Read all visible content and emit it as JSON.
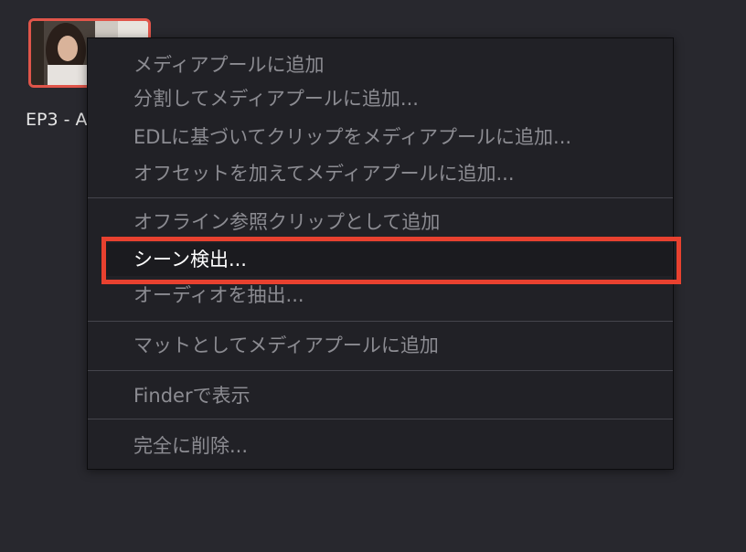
{
  "clip": {
    "label": "EP3 - A"
  },
  "context_menu": {
    "items": [
      {
        "label": "メディアプールに追加"
      },
      {
        "label": "分割してメディアプールに追加..."
      },
      {
        "label": "EDLに基づいてクリップをメディアプールに追加..."
      },
      {
        "label": "オフセットを加えてメディアプールに追加..."
      },
      {
        "label": "オフライン参照クリップとして追加"
      },
      {
        "label": "シーン検出...",
        "highlighted": true
      },
      {
        "label": "オーディオを抽出..."
      },
      {
        "label": "マットとしてメディアプールに追加"
      },
      {
        "label": "Finderで表示"
      },
      {
        "label": "完全に削除..."
      }
    ]
  },
  "colors": {
    "highlight_annotation": "#e8412f",
    "thumbnail_border": "#e0554a"
  }
}
